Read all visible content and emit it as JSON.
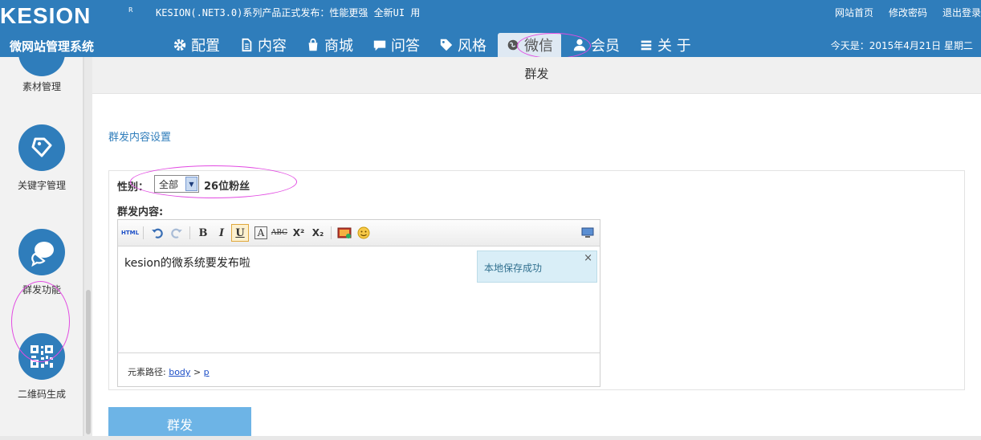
{
  "header": {
    "logo_text": "KESION",
    "logo_mark": "R",
    "announcement": "KESION(.NET3.0)系列产品正式发布：性能更强 全新UI 用",
    "top_links": [
      "网站首页",
      "修改密码",
      "退出登录"
    ],
    "system_name": "微网站管理系统",
    "date_text": "今天是：2015年4月21日 星期二"
  },
  "nav": {
    "items": [
      {
        "label": "配置",
        "icon": "gear-icon"
      },
      {
        "label": "内容",
        "icon": "document-icon"
      },
      {
        "label": "商城",
        "icon": "shopping-bag-icon"
      },
      {
        "label": "问答",
        "icon": "chat-bubble-icon"
      },
      {
        "label": "风格",
        "icon": "tag-icon"
      },
      {
        "label": "微信",
        "icon": "wechat-globe-icon"
      },
      {
        "label": "会员",
        "icon": "user-icon"
      },
      {
        "label": "关 于",
        "icon": "list-icon"
      }
    ],
    "active": "微信"
  },
  "sidebar": {
    "items": [
      {
        "label": "素材管理",
        "icon": "material-icon"
      },
      {
        "label": "关键字管理",
        "icon": "keyword-tag-icon"
      },
      {
        "label": "群发功能",
        "icon": "broadcast-chat-icon"
      },
      {
        "label": "二维码生成",
        "icon": "qr-code-icon"
      }
    ],
    "active": "群发功能"
  },
  "page": {
    "title": "群发",
    "section_title": "群发内容设置"
  },
  "form": {
    "gender_label": "性别：",
    "gender_value": "全部",
    "fans_count": "26位粉丝",
    "content_label": "群发内容:",
    "editor_text": "kesion的微系统要发布啦",
    "path_label": "元素路径:",
    "path_body": "body",
    "path_sep": ">",
    "path_p": "p",
    "toast_text": "本地保存成功",
    "toast_close": "×",
    "submit_label": "群发"
  },
  "toolbar": {
    "html": "HTML",
    "bold": "B",
    "italic": "I",
    "underline": "U",
    "font_color": "A",
    "strike": "ABC",
    "superscript": "X²",
    "subscript": "X₂"
  },
  "colors": {
    "header_bg": "#2f7dbb",
    "accent": "#2f7dbb",
    "button": "#6db4e6",
    "annotation": "#e24be2"
  }
}
